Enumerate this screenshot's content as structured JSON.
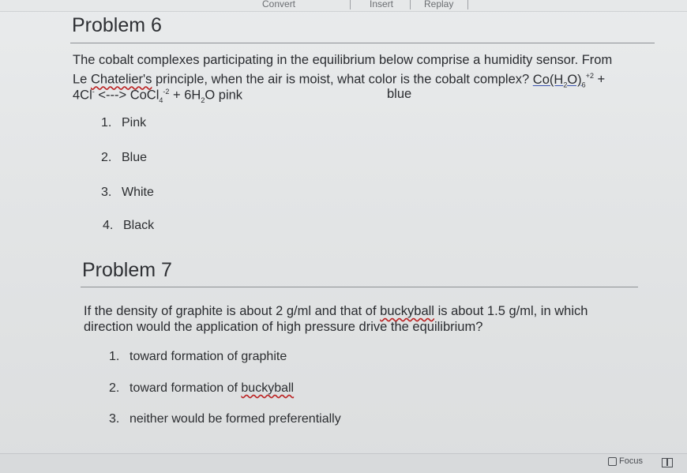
{
  "toolbar": {
    "convert": "Convert",
    "insert": "Insert",
    "replay": "Replay"
  },
  "problem6": {
    "title": "Problem 6",
    "text_a": "The cobalt complexes participating in the equilibrium below comprise a humidity sensor. From",
    "le": "Le",
    "chatelier": "Chatelier's",
    "text_b": "principle, when the air is moist, what color is the cobalt complex?",
    "complex1": "Co(H",
    "sub2": "2",
    "o_close": "O)",
    "sub6": "6",
    "sup_plus2": "+2",
    "plus": "+",
    "line3_a": "4Cl",
    "sup_minus": "-",
    "arrow": "<--->",
    "cocl": "CoCl",
    "sub4": "4",
    "sup_minus2": "-2",
    "line3_b": "+ 6H",
    "sub2b": "2",
    "line3_c": "O pink",
    "blue_label": "blue",
    "options": [
      {
        "num": "1.",
        "label": "Pink"
      },
      {
        "num": "2.",
        "label": "Blue"
      },
      {
        "num": "3.",
        "label": "White"
      },
      {
        "num": "4.",
        "label": "Black"
      }
    ]
  },
  "problem7": {
    "title": "Problem 7",
    "text_a1": "If the density of graphite is about 2 g/ml and that of",
    "buckyball": "buckyball",
    "text_a2": "is about 1.5 g/ml, in which",
    "text_b": "direction would the application of high pressure drive the equilibrium?",
    "options": [
      {
        "num": "1.",
        "label": "toward formation of graphite"
      },
      {
        "num": "2.",
        "label": "toward formation of",
        "wavy": "buckyball"
      },
      {
        "num": "3.",
        "label": "neither would be formed preferentially"
      }
    ]
  },
  "footer": {
    "focus": "Focus"
  }
}
